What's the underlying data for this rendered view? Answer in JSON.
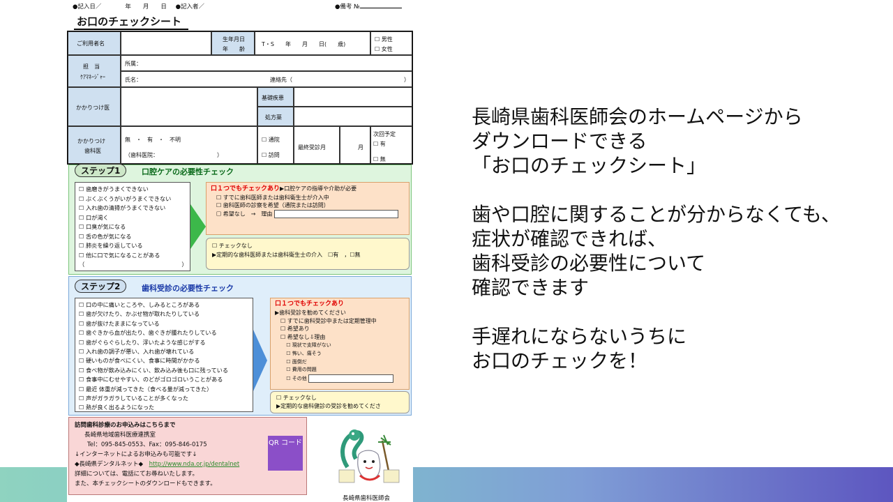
{
  "sheet": {
    "header": {
      "entry_date": "●記入日／　　　　年　　月　　日",
      "writer": "●記入者／",
      "memo": "●備考 №"
    },
    "title": "お口のチェックシート",
    "info": {
      "user_name": "ご利用者名",
      "birth": "生年月日",
      "age": "年　　齢",
      "era": "T・S　　年　　月　　日(　　歳)",
      "male": "☐ 男性",
      "female": "☐ 女性",
      "care_manager1": "担　当",
      "care_manager2": "ｹｱﾏﾈｰｼﾞｬｰ",
      "affiliation": "所属：",
      "name": "氏名：",
      "contact": "連絡先（　　　　　　　　　　　　　　　　　　　　）",
      "doctor": "かかりつけ医",
      "disease": "基礎疾患",
      "prescription": "処方薬",
      "dentist1": "かかりつけ",
      "dentist2": "歯科医",
      "dentist_opts": "無　・　有　・　不明",
      "dentist_clinic": "（歯科医院：　　　　　　　　　　　）",
      "outpatient": "☐ 通院",
      "visit": "☐ 訪問",
      "last_visit": "最終受診月",
      "month": "月",
      "next_plan": "次回予定",
      "next_yes": "☐ 有",
      "next_no": "☐ 無"
    },
    "step1": {
      "pill": "ステップ1",
      "title": "口腔ケアの必要性チェック",
      "items": [
        "☐ 歯磨きがうまくできない",
        "☐ ぶくぶくうがいがうまくできない",
        "☐ 入れ歯の清掃がうまくできない",
        "☐ 口が渇く",
        "☐ 口臭が気になる",
        "☐ 舌の色が気になる",
        "☐ 肺炎を繰り返している",
        "☐ 他に口で気になることがある",
        "（　　　　　　　　　　　　　　　　　）"
      ],
      "alert_head": "口１つでもチェックあり",
      "alert_rest": "▶口腔ケアの指導や介助が必要",
      "alert_items": [
        "☐ すでに歯科医師または歯科衛生士が介入中",
        "☐ 歯科医師の診察を希望（通院または訪問）",
        "☐ 希望なし　→　理由"
      ],
      "none_head": "☐ チェックなし",
      "none_text": "▶定期的な歯科医師または歯科衛生士の介入　☐有　，☐無"
    },
    "step2": {
      "pill": "ステップ2",
      "title": "歯科受診の必要性チェック",
      "items": [
        "☐ 口の中に痛いところや、しみるところがある",
        "☐ 歯が欠けたり、かぶせ物が取れたりしている",
        "☐ 歯が抜けたままになっている",
        "☐ 歯ぐきから血が出たり、歯ぐきが腫れたりしている",
        "☐ 歯がぐらぐらしたり、浮いたような感じがする",
        "☐ 入れ歯の調子が悪い、入れ歯が壊れている",
        "☐ 硬いものが食べにくい、食事に時間がかかる",
        "☐ 食べ物が飲み込みにくい、飲み込み後も口に残っている",
        "☐ 食事中にむせやすい、のどがゴロゴロいうことがある",
        "☐ 最近 体重が減ってきた（食べる量が減ってきた）",
        "☐ 声がガラガラしていることが多くなった",
        "☐ 熱が良く出るようになった"
      ],
      "alert_head": "口１つでもチェックあり",
      "alert_items": [
        "▶歯科受診を勧めてください",
        "　☐ すでに歯科受診中または定期管理中",
        "　☐ 希望あり",
        "　☐ 希望なし⇩理由",
        "　　 ☐ 現状で支障がない",
        "　　 ☐ 怖い、痛そう",
        "　　 ☐ 面倒だ",
        "　　 ☐ 費用の問題",
        "　　 ☐ その他"
      ],
      "none_head": "☐ チェックなし",
      "none_text": "▶定期的な歯科健診の受診を勧めてくださ"
    },
    "visit": {
      "title": "訪問歯科診療のお申込みはこちらまで",
      "org": "長崎県地域歯科医療連携室",
      "tel": "Tel：095-845-0553、Fax：095-846-0175",
      "internet": "↓インターネットによるお申込みも可能です↓",
      "portal_label": "◆長崎県デンタルネット◆",
      "url": "http://www.nda.or.jp/dentalnet",
      "detail": "詳細については、電話にてお尋ねいたします。",
      "download": "また、本チェックシートのダウンロードもできます。",
      "qr": "QR コード"
    },
    "association": "長崎県歯科医師会"
  },
  "message": {
    "p1": [
      "長崎県歯科医師会のホームページから",
      "ダウンロードできる",
      "「お口のチェックシート」"
    ],
    "p2": [
      "歯や口腔に関することが分からなくても、",
      "症状が確認できれば、",
      "歯科受診の必要性について",
      "確認できます"
    ],
    "p3": [
      "手遅れにならないうちに",
      "お口のチェックを！"
    ]
  },
  "colors": {
    "band_start": "#8fd3c0",
    "band_end": "#5d56c0",
    "step1_bg": "#def5de",
    "step2_bg": "#dfeefa",
    "alert_bg": "#fde1c8",
    "visit_bg": "#f9d6d6",
    "qr_bg": "#8b4fc8"
  }
}
